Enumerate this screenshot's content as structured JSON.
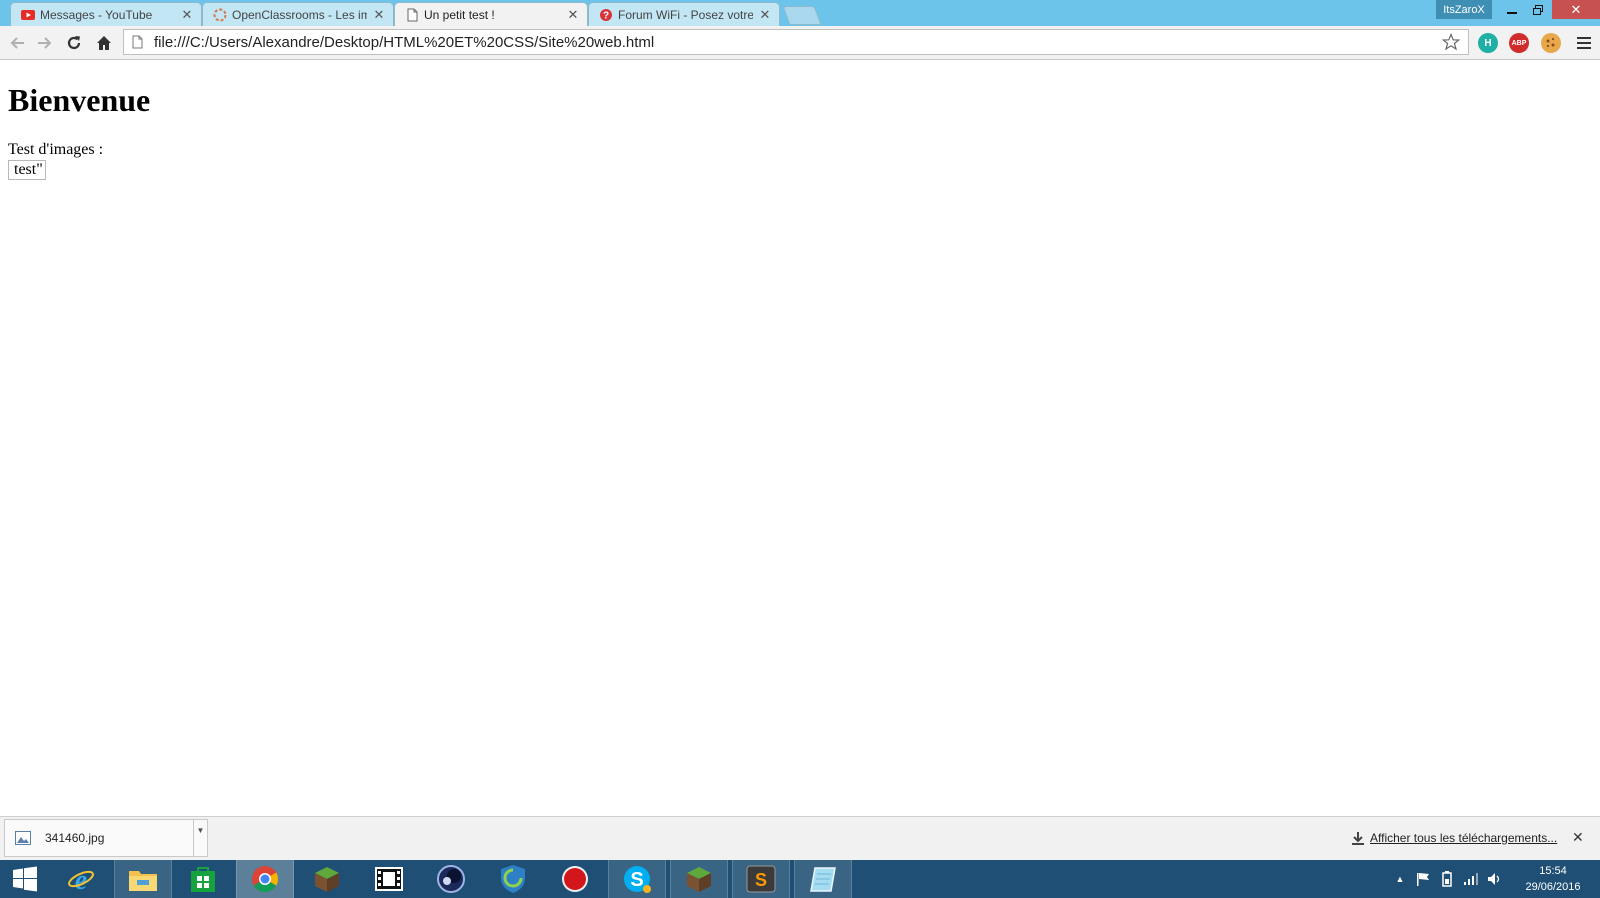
{
  "tabs": [
    {
      "title": "Messages - YouTube",
      "active": false,
      "favicon": "youtube-icon"
    },
    {
      "title": "OpenClassrooms - Les im",
      "active": false,
      "favicon": "openclassrooms-icon"
    },
    {
      "title": "Un petit test !",
      "active": true,
      "favicon": "page-icon"
    },
    {
      "title": "Forum WiFi - Posez votre",
      "active": false,
      "favicon": "forum-icon"
    }
  ],
  "window": {
    "user": "ItsZaroX"
  },
  "toolbar": {
    "url": "file:///C:/Users/Alexandre/Desktop/HTML%20ET%20CSS/Site%20web.html",
    "extensions": [
      {
        "name": "h-extension-icon",
        "label": "H",
        "color": "#1fb0a5"
      },
      {
        "name": "adblock-plus-icon",
        "label": "ABP",
        "color": "#d12c2c"
      },
      {
        "name": "cookie-icon",
        "label": "",
        "color": "#e7a84b"
      }
    ]
  },
  "page": {
    "heading": "Bienvenue",
    "text": "Test d'images :",
    "image_alt": "test\""
  },
  "downloads": {
    "file": "341460.jpg",
    "show_all": "Afficher tous les téléchargements..."
  },
  "taskbar": {
    "apps": [
      "start-icon",
      "internet-explorer-icon",
      "file-explorer-icon",
      "windows-store-icon",
      "chrome-icon",
      "minecraft-icon",
      "video-editor-icon",
      "cinema4d-icon",
      "security-shield-icon",
      "record-icon",
      "skype-icon",
      "minecraft-icon",
      "sublime-text-icon",
      "notepad-icon"
    ],
    "time": "15:54",
    "date": "29/06/2016"
  }
}
